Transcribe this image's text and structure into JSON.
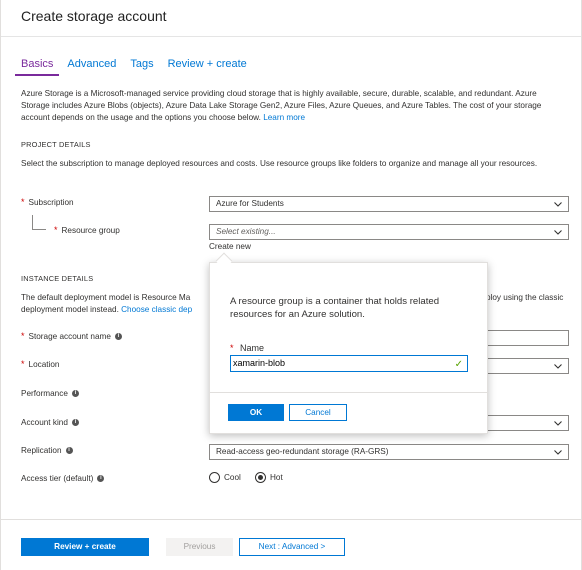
{
  "header": {
    "title": "Create storage account"
  },
  "tabs": [
    {
      "label": "Basics",
      "active": true
    },
    {
      "label": "Advanced",
      "active": false
    },
    {
      "label": "Tags",
      "active": false
    },
    {
      "label": "Review + create",
      "active": false
    }
  ],
  "intro": {
    "text": "Azure Storage is a Microsoft-managed service providing cloud storage that is highly available, secure, durable, scalable, and redundant. Azure Storage includes Azure Blobs (objects), Azure Data Lake Storage Gen2, Azure Files, Azure Queues, and Azure Tables. The cost of your storage account depends on the usage and the options you choose below.",
    "link": "Learn more"
  },
  "project": {
    "heading": "PROJECT DETAILS",
    "description": "Select the subscription to manage deployed resources and costs. Use resource groups like folders to organize and manage all your resources.",
    "subscription_label": "Subscription",
    "subscription_value": "Azure for Students",
    "resource_group_label": "Resource group",
    "resource_group_placeholder": "Select existing...",
    "create_new_link": "Create new"
  },
  "instance": {
    "heading": "INSTANCE DETAILS",
    "description_left": "The default deployment model is Resource Ma",
    "description_right": "ploy using the classic",
    "description_line2_text": "deployment model instead.",
    "description_line2_link": "Choose classic dep",
    "storage_name_label": "Storage account name",
    "location_label": "Location",
    "performance_label": "Performance",
    "account_kind_label": "Account kind",
    "replication_label": "Replication",
    "replication_value": "Read-access geo-redundant storage (RA-GRS)",
    "access_tier_label": "Access tier (default)",
    "access_tier_options": [
      "Cool",
      "Hot"
    ],
    "access_tier_selected": "Hot"
  },
  "popup": {
    "text": "A resource group is a container that holds related resources for an Azure solution.",
    "name_label": "Name",
    "name_value": "xamarin-blob",
    "ok_label": "OK",
    "cancel_label": "Cancel"
  },
  "footer": {
    "review_label": "Review + create",
    "previous_label": "Previous",
    "next_label": "Next : Advanced >"
  },
  "colors": {
    "accent": "#0078d4",
    "active_tab": "#7a2a9c",
    "required": "#c00000",
    "valid": "#57a300"
  },
  "icons": {
    "info": "info-icon",
    "dropdown": "chevron-down-icon",
    "valid": "checkmark-icon"
  }
}
